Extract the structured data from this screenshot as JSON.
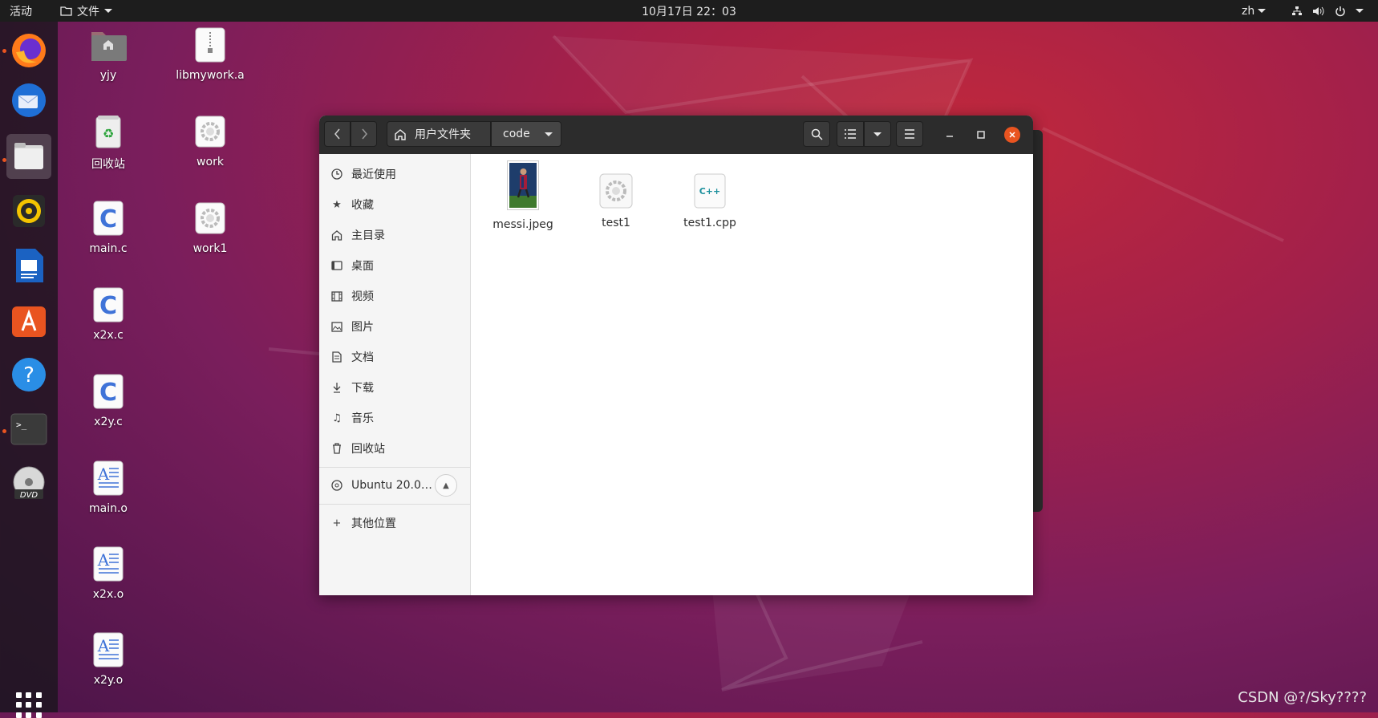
{
  "topbar": {
    "activities": "活动",
    "app_menu": "文件",
    "clock": "10月17日 22：03",
    "language": "zh"
  },
  "dock": {
    "items": [
      "firefox-icon",
      "thunderbird-icon",
      "files-icon",
      "rhythmbox-icon",
      "writer-icon",
      "software-icon",
      "help-icon",
      "terminal-icon",
      "dvd-icon"
    ],
    "running_indicator_color": "#e95420"
  },
  "desktop": {
    "icons": [
      {
        "label": "yjy",
        "icon": "home-folder-icon"
      },
      {
        "label": "libmywork.a",
        "icon": "archive-icon"
      },
      {
        "label": "回收站",
        "icon": "trash-icon"
      },
      {
        "label": "work",
        "icon": "executable-icon"
      },
      {
        "label": "main.c",
        "icon": "c-source-icon"
      },
      {
        "label": "work1",
        "icon": "executable-icon"
      },
      {
        "label": "x2x.c",
        "icon": "c-source-icon"
      },
      {
        "label": "x2y.c",
        "icon": "c-source-icon"
      },
      {
        "label": "main.o",
        "icon": "object-file-icon"
      },
      {
        "label": "x2x.o",
        "icon": "object-file-icon"
      },
      {
        "label": "x2y.o",
        "icon": "object-file-icon"
      }
    ]
  },
  "window": {
    "path": {
      "home_label": "用户文件夹",
      "current": "code"
    },
    "sidebar": {
      "items": [
        {
          "label": "最近使用",
          "icon": "clock-icon"
        },
        {
          "label": "收藏",
          "icon": "star-icon"
        },
        {
          "label": "主目录",
          "icon": "home-icon"
        },
        {
          "label": "桌面",
          "icon": "desktop-icon"
        },
        {
          "label": "视频",
          "icon": "video-icon"
        },
        {
          "label": "图片",
          "icon": "picture-icon"
        },
        {
          "label": "文档",
          "icon": "document-icon"
        },
        {
          "label": "下载",
          "icon": "download-icon"
        },
        {
          "label": "音乐",
          "icon": "music-icon"
        },
        {
          "label": "回收站",
          "icon": "trash-icon"
        }
      ],
      "device": "Ubuntu 20.0…",
      "other_locations": "其他位置"
    },
    "files": [
      {
        "name": "messi.jpeg",
        "icon": "image-thumbnail-icon"
      },
      {
        "name": "test1",
        "icon": "executable-icon"
      },
      {
        "name": "test1.cpp",
        "icon": "cpp-source-icon",
        "badge": "C++"
      }
    ]
  },
  "watermark": "CSDN @?/Sky????",
  "colors": {
    "accent": "#e95420",
    "topbar": "#1d1d1d",
    "headerbar": "#2c2c2c"
  }
}
